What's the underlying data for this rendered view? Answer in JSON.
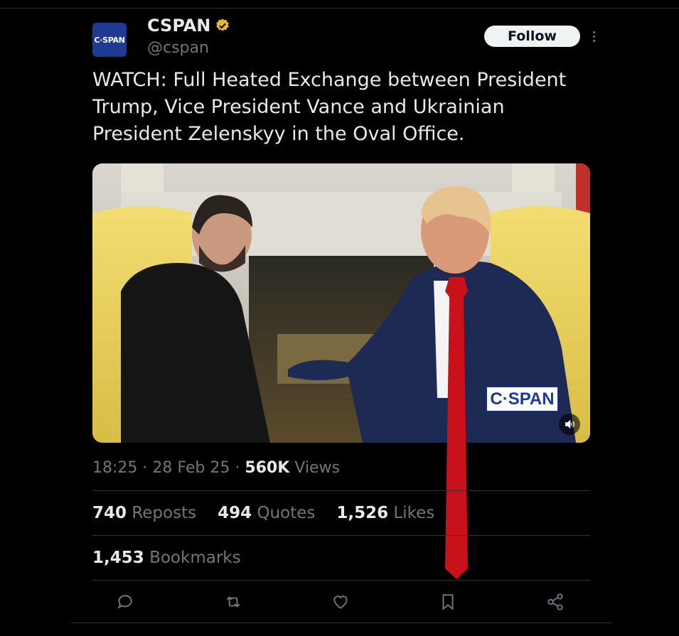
{
  "account": {
    "name": "CSPAN",
    "handle": "@cspan",
    "avatar_text": "C·SPAN",
    "verified": true
  },
  "follow_label": "Follow",
  "tweet_text": "WATCH: Full Heated Exchange between President Trump, Vice President Vance and Ukrainian President Zelenskyy in the Oval Office.",
  "media": {
    "watermark": "C·SPAN",
    "mute_icon": "speaker-icon"
  },
  "meta": {
    "time": "18:25",
    "date": "28 Feb 25",
    "views_count": "560K",
    "views_label": "Views"
  },
  "stats": {
    "reposts_count": "740",
    "reposts_label": "Reposts",
    "quotes_count": "494",
    "quotes_label": "Quotes",
    "likes_count": "1,526",
    "likes_label": "Likes",
    "bookmarks_count": "1,453",
    "bookmarks_label": "Bookmarks"
  },
  "actions": [
    "reply-icon",
    "repost-icon",
    "like-icon",
    "bookmark-icon",
    "share-icon"
  ],
  "colors": {
    "background": "#000000",
    "text": "#e7e9ea",
    "muted": "#71767b",
    "verified_badge": "#e8b829",
    "brand": "#1f3a93"
  }
}
